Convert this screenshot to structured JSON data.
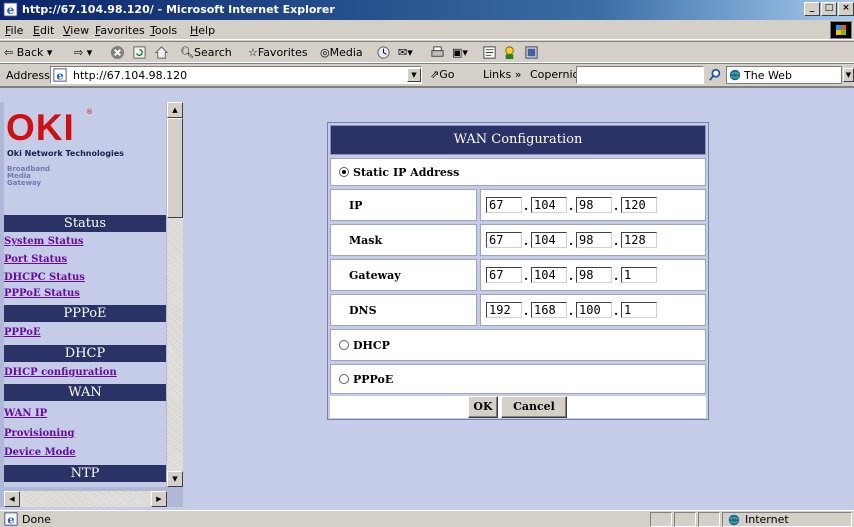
{
  "window": {
    "title": "http://67.104.98.120/ - Microsoft Internet Explorer"
  },
  "menu": [
    "File",
    "Edit",
    "View",
    "Favorites",
    "Tools",
    "Help"
  ],
  "toolbar": {
    "back": "Back",
    "search": "Search",
    "favorites": "Favorites",
    "media": "Media"
  },
  "address": {
    "label": "Address",
    "url": "http://67.104.98.120",
    "go": "Go",
    "links": "Links",
    "copernic": "Copernic Agent",
    "web": "The Web"
  },
  "sidebar": {
    "logo": "OKI",
    "logo_reg": "®",
    "logo_sub": "Oki Network Technologies",
    "logo_desc": "Broadband\nMedia\nGateway",
    "sections": {
      "status": "Status",
      "pppoe": "PPPoE",
      "dhcp": "DHCP",
      "wan": "WAN",
      "ntp": "NTP"
    },
    "links": {
      "system_status": "System Status",
      "port_status": "Port Status",
      "dhcpc_status": "DHCPC Status",
      "pppoe_status": "PPPoE Status",
      "pppoe": "PPPoE",
      "dhcp_configuration": "DHCP configuration",
      "wan_ip": "WAN IP",
      "provisioning": "Provisioning",
      "device_mode": "Device Mode"
    }
  },
  "wan": {
    "title": "WAN Configuration",
    "static_label": "Static IP Address",
    "dhcp_label": "DHCP",
    "pppoe_label": "PPPoE",
    "selected": "static",
    "fields": {
      "ip": {
        "label": "IP",
        "octets": [
          "67",
          "104",
          "98",
          "120"
        ]
      },
      "mask": {
        "label": "Mask",
        "octets": [
          "67",
          "104",
          "98",
          "128"
        ]
      },
      "gateway": {
        "label": "Gateway",
        "octets": [
          "67",
          "104",
          "98",
          "1"
        ]
      },
      "dns": {
        "label": "DNS",
        "octets": [
          "192",
          "168",
          "100",
          "1"
        ]
      }
    },
    "ok": "OK",
    "cancel": "Cancel"
  },
  "status": {
    "text": "Done",
    "zone": "Internet"
  }
}
